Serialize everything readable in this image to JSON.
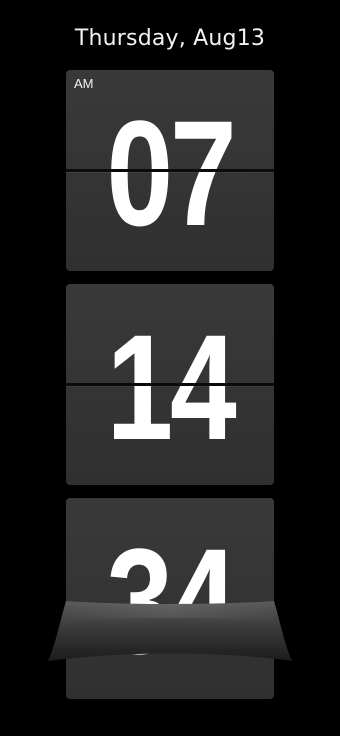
{
  "date_label": "Thursday, Aug13",
  "clock": {
    "am_pm": "AM",
    "hours": "07",
    "minutes": "14",
    "seconds": "34"
  },
  "colors": {
    "background": "#000000",
    "card": "#353535",
    "digit": "#ffffff"
  }
}
